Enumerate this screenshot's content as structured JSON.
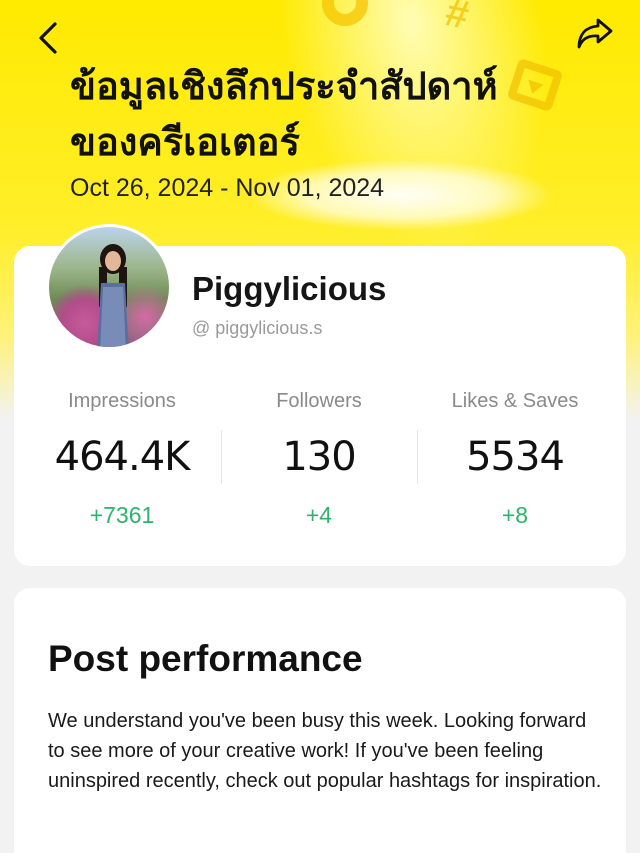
{
  "header": {
    "title": "ข้อมูลเชิงลึกประจำสัปดาห์ของครีเอเตอร์",
    "date_range": "Oct 26, 2024 - Nov 01, 2024",
    "back_icon": "chevron-left-icon",
    "share_icon": "share-arrow-icon"
  },
  "profile": {
    "name": "Piggylicious",
    "handle": "@ piggylicious.s"
  },
  "stats": [
    {
      "label": "Impressions",
      "value": "464.4K",
      "change": "+7361"
    },
    {
      "label": "Followers",
      "value": "130",
      "change": "+4"
    },
    {
      "label": "Likes & Saves",
      "value": "5534",
      "change": "+8"
    }
  ],
  "post_performance": {
    "title": "Post performance",
    "text": "We understand you've been busy this week. Looking forward to see more of your creative work! If you've been feeling uninspired recently, check out popular hashtags for inspiration."
  },
  "colors": {
    "accent_yellow": "#ffea00",
    "positive_green": "#2db36b"
  }
}
